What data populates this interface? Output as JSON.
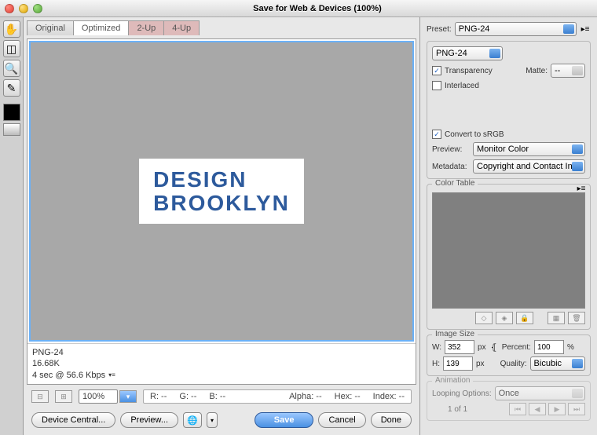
{
  "title": "Save for Web & Devices (100%)",
  "tabs": {
    "original": "Original",
    "optimized": "Optimized",
    "twoup": "2-Up",
    "fourup": "4-Up"
  },
  "logo": {
    "line1": "DESIGN",
    "line2": "BROOKLYN"
  },
  "info": {
    "format": "PNG-24",
    "size": "16.68K",
    "time": "4 sec @ 56.6 Kbps"
  },
  "zoom": "100%",
  "readout": {
    "r": "R: --",
    "g": "G: --",
    "b": "B: --",
    "alpha": "Alpha: --",
    "hex": "Hex: --",
    "index": "Index: --"
  },
  "bottom": {
    "deviceCentral": "Device Central...",
    "preview": "Preview...",
    "save": "Save",
    "cancel": "Cancel",
    "done": "Done"
  },
  "right": {
    "presetLabel": "Preset:",
    "preset": "PNG-24",
    "format": "PNG-24",
    "transparency": "Transparency",
    "matteLabel": "Matte:",
    "matte": "--",
    "interlaced": "Interlaced",
    "convert": "Convert to sRGB",
    "previewLabel": "Preview:",
    "preview": "Monitor Color",
    "metaLabel": "Metadata:",
    "meta": "Copyright and Contact Info",
    "colorTable": "Color Table",
    "imageSize": "Image Size",
    "wLabel": "W:",
    "w": "352",
    "px": "px",
    "hLabel": "H:",
    "h": "139",
    "percentLabel": "Percent:",
    "percent": "100",
    "pct": "%",
    "qualityLabel": "Quality:",
    "quality": "Bicubic",
    "animation": "Animation",
    "loopLabel": "Looping Options:",
    "loop": "Once",
    "frame": "1 of 1"
  }
}
